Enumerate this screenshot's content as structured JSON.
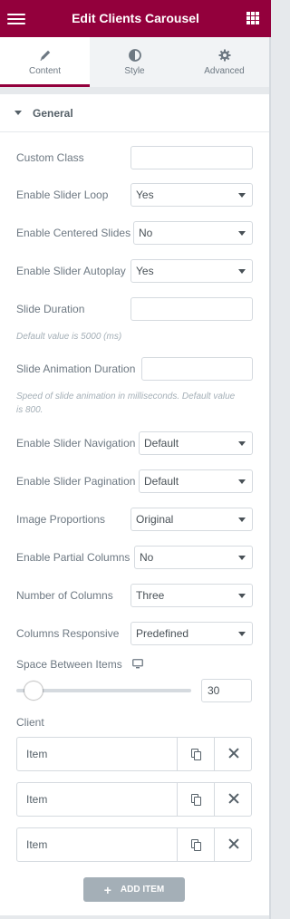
{
  "header": {
    "title": "Edit Clients Carousel",
    "menu_icon": "hamburger-icon",
    "apps_icon": "grid-icon"
  },
  "tabs": [
    {
      "label": "Content",
      "icon": "pencil-icon",
      "active": true
    },
    {
      "label": "Style",
      "icon": "half-circle-icon",
      "active": false
    },
    {
      "label": "Advanced",
      "icon": "gear-icon",
      "active": false
    }
  ],
  "section": {
    "title": "General"
  },
  "fields": {
    "custom_class": {
      "label": "Custom Class",
      "value": ""
    },
    "slider_loop": {
      "label": "Enable Slider Loop",
      "value": "Yes"
    },
    "centered_slides": {
      "label": "Enable Centered Slides",
      "value": "No"
    },
    "autoplay": {
      "label": "Enable Slider Autoplay",
      "value": "Yes"
    },
    "slide_duration": {
      "label": "Slide Duration",
      "value": "",
      "hint": "Default value is 5000 (ms)"
    },
    "animation_duration": {
      "label": "Slide Animation Duration",
      "value": "",
      "hint": "Speed of slide animation in milliseconds. Default value is 800."
    },
    "navigation": {
      "label": "Enable Slider Navigation",
      "value": "Default"
    },
    "pagination": {
      "label": "Enable Slider Pagination",
      "value": "Default"
    },
    "image_proportions": {
      "label": "Image Proportions",
      "value": "Original"
    },
    "partial_columns": {
      "label": "Enable Partial Columns",
      "value": "No"
    },
    "columns": {
      "label": "Number of Columns",
      "value": "Three"
    },
    "columns_responsive": {
      "label": "Columns Responsive",
      "value": "Predefined"
    },
    "space_between": {
      "label": "Space Between Items",
      "value": "30",
      "icon": "desktop-icon"
    }
  },
  "client": {
    "label": "Client",
    "items": [
      {
        "name": "Item"
      },
      {
        "name": "Item"
      },
      {
        "name": "Item"
      }
    ],
    "add_label": "ADD ITEM"
  }
}
